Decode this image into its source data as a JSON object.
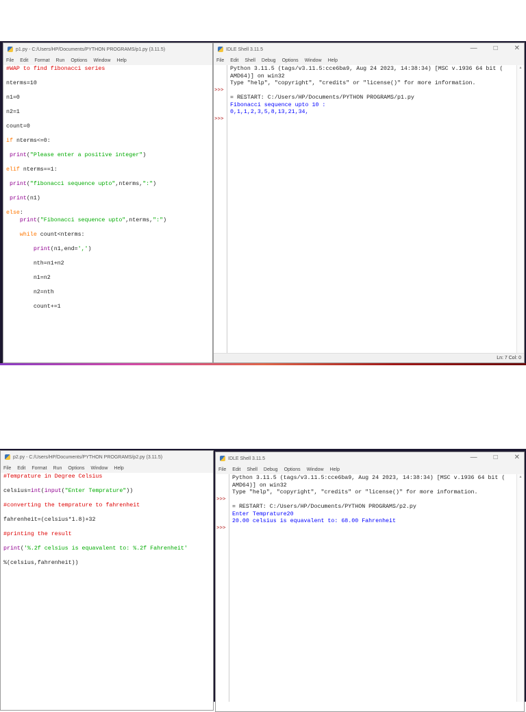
{
  "screen1": {
    "editor": {
      "title": "p1.py - C:/Users/HP/Documents/PYTHON PROGRAMS/p1.py (3.11.5)",
      "menu": [
        "File",
        "Edit",
        "Format",
        "Run",
        "Options",
        "Window",
        "Help"
      ],
      "lines": [
        [
          [
            "#WAP to find fibonacci series",
            "com"
          ]
        ],
        [],
        [
          [
            "nterms=10",
            ""
          ]
        ],
        [],
        [
          [
            "n1=0",
            ""
          ]
        ],
        [],
        [
          [
            "n2=1",
            ""
          ]
        ],
        [],
        [
          [
            "count=0",
            ""
          ]
        ],
        [],
        [
          [
            "if",
            "kw"
          ],
          [
            " nterms<=0:",
            ""
          ]
        ],
        [],
        [
          [
            " ",
            ""
          ],
          [
            "print",
            "bi"
          ],
          [
            "(",
            ""
          ],
          [
            "\"Please enter a positive integer\"",
            "str"
          ],
          [
            ")",
            ""
          ]
        ],
        [],
        [
          [
            "elif",
            "kw"
          ],
          [
            " nterms==1:",
            ""
          ]
        ],
        [],
        [
          [
            " ",
            ""
          ],
          [
            "print",
            "bi"
          ],
          [
            "(",
            ""
          ],
          [
            "\"fibonacci sequence upto\"",
            "str"
          ],
          [
            ",nterms,",
            ""
          ],
          [
            "\":\"",
            "str"
          ],
          [
            ")",
            ""
          ]
        ],
        [],
        [
          [
            " ",
            ""
          ],
          [
            "print",
            "bi"
          ],
          [
            "(n1)",
            ""
          ]
        ],
        [],
        [
          [
            "else",
            "kw"
          ],
          [
            ":",
            ""
          ]
        ],
        [
          [
            "    ",
            ""
          ],
          [
            "print",
            "bi"
          ],
          [
            "(",
            ""
          ],
          [
            "\"Fibonacci sequence upto\"",
            "str"
          ],
          [
            ",nterms,",
            ""
          ],
          [
            "\":\"",
            "str"
          ],
          [
            ")",
            ""
          ]
        ],
        [],
        [
          [
            "    ",
            ""
          ],
          [
            "while",
            "kw"
          ],
          [
            " count<nterms:",
            ""
          ]
        ],
        [],
        [
          [
            "        ",
            ""
          ],
          [
            "print",
            "bi"
          ],
          [
            "(n1,end=",
            ""
          ],
          [
            "','",
            "str"
          ],
          [
            ")",
            ""
          ]
        ],
        [],
        [
          [
            "        nth=n1+n2",
            ""
          ]
        ],
        [],
        [
          [
            "        n1=n2",
            ""
          ]
        ],
        [],
        [
          [
            "        n2=nth",
            ""
          ]
        ],
        [],
        [
          [
            "        count+=1",
            ""
          ]
        ]
      ]
    },
    "shell": {
      "title": "IDLE Shell 3.11.5",
      "menu": [
        "File",
        "Edit",
        "Shell",
        "Debug",
        "Options",
        "Window",
        "Help"
      ],
      "prompt": ">>>",
      "lines": [
        [
          [
            "Python 3.11.5 (tags/v3.11.5:cce6ba9, Aug 24 2023, 14:38:34) [MSC v.1936 64 bit (",
            ""
          ]
        ],
        [
          [
            "AMD64)] on win32",
            ""
          ]
        ],
        [
          [
            "Type \"help\", \"copyright\", \"credits\" or \"license()\" for more information.",
            ""
          ]
        ],
        [],
        [
          [
            "= RESTART: C:/Users/HP/Documents/PYTHON PROGRAMS/p1.py",
            ""
          ]
        ],
        [
          [
            "Fibonacci sequence upto 10 :",
            "out"
          ]
        ],
        [
          [
            "0,1,1,2,3,5,8,13,21,34,",
            "out"
          ]
        ]
      ],
      "status": "Ln: 7   Col: 0"
    }
  },
  "screen2": {
    "editor": {
      "title": "p2.py - C:/Users/HP/Documents/PYTHON PROGRAMS/p2.py (3.11.5)",
      "menu": [
        "File",
        "Edit",
        "Format",
        "Run",
        "Options",
        "Window",
        "Help"
      ],
      "lines": [
        [
          [
            "#Temprature in Degree Celsius",
            "com"
          ]
        ],
        [],
        [
          [
            "celsius=",
            ""
          ],
          [
            "int",
            "bi"
          ],
          [
            "(",
            ""
          ],
          [
            "input",
            "bi"
          ],
          [
            "(",
            ""
          ],
          [
            "\"Enter Temprature\"",
            "str"
          ],
          [
            "))",
            ""
          ]
        ],
        [],
        [
          [
            "#converting the temprature to fahrenheit",
            "com"
          ]
        ],
        [],
        [
          [
            "fahrenheit=(celsius*1.8)+32",
            ""
          ]
        ],
        [],
        [
          [
            "#printing the result",
            "com"
          ]
        ],
        [],
        [
          [
            "print",
            "bi"
          ],
          [
            "(",
            ""
          ],
          [
            "'%.2f celsius is equavalent to: %.2f Fahrenheit'",
            "str"
          ]
        ],
        [],
        [
          [
            "%(celsius,fahrenheit))",
            ""
          ]
        ]
      ]
    },
    "shell": {
      "title": "IDLE Shell 3.11.5",
      "menu": [
        "File",
        "Edit",
        "Shell",
        "Debug",
        "Options",
        "Window",
        "Help"
      ],
      "prompt": ">>>",
      "lines": [
        [
          [
            "Python 3.11.5 (tags/v3.11.5:cce6ba9, Aug 24 2023, 14:38:34) [MSC v.1936 64 bit (",
            ""
          ]
        ],
        [
          [
            "AMD64)] on win32",
            ""
          ]
        ],
        [
          [
            "Type \"help\", \"copyright\", \"credits\" or \"license()\" for more information.",
            ""
          ]
        ],
        [],
        [
          [
            "= RESTART: C:/Users/HP/Documents/PYTHON PROGRAMS/p2.py",
            ""
          ]
        ],
        [
          [
            "Enter Temprature20",
            "out"
          ]
        ],
        [
          [
            "20.00 celsius is equavalent to: 68.00 Fahrenheit",
            "out"
          ]
        ]
      ]
    }
  }
}
